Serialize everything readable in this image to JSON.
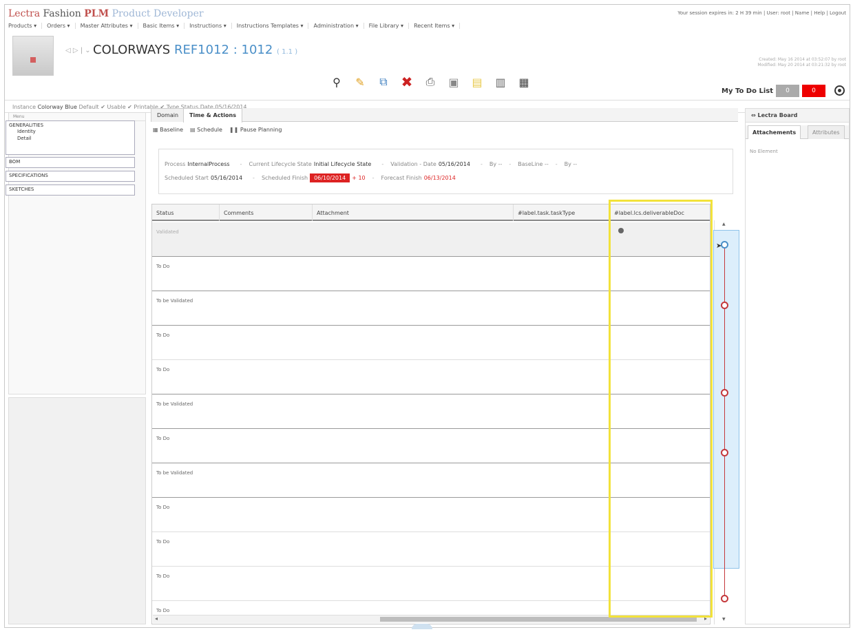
{
  "brand": {
    "part1": "Lectra",
    "part2": "Fashion",
    "part3": "PLM",
    "part4": "Product Developer"
  },
  "session": {
    "text": "Your session expires in: 2 H 39 min | User: root | Name | Help | Logout"
  },
  "menu": [
    "Products ▾",
    "Orders ▾",
    "Master Attributes ▾",
    "Basic Items ▾",
    "Instructions ▾",
    "Instructions Templates ▾",
    "Administration ▾",
    "File Library ▾",
    "Recent Items ▾"
  ],
  "title": {
    "prefix": "COLORWAYS",
    "ref": "REF1012 : 1012",
    "version": "( 1.1 )"
  },
  "created": {
    "line1": "Created: May 16 2014 at 03:52:07 by root",
    "line2": "Modified: May 20 2014 at 03:21:32 by root"
  },
  "todo": {
    "label": "My To Do List",
    "count_grey": "0",
    "count_red": "0"
  },
  "instance": {
    "label": "Instance",
    "value": "Colorway Blue",
    "default": "Default ✔",
    "usable": "Usable ✔",
    "printable": "Printable ✔",
    "type": "Type",
    "status": "Status",
    "date": "Date 05/16/2014"
  },
  "left_nav": {
    "header": "Menu",
    "groups": [
      {
        "label": "GENERALITIES",
        "items": [
          "Identity",
          "Detail"
        ]
      },
      {
        "label": "BOM"
      },
      {
        "label": "SPECIFICATIONS"
      },
      {
        "label": "SKETCHES"
      }
    ]
  },
  "tabs": {
    "domain": "Domain",
    "time_actions": "Time & Actions"
  },
  "subtool": {
    "baseline": "Baseline",
    "schedule": "Schedule",
    "pause": "Pause Planning"
  },
  "process": {
    "process_label": "Process",
    "process_value": "InternalProcess",
    "state_label": "Current Lifecycle State",
    "state_value": "Initial Lifecycle State",
    "validation_label": "Validation - Date",
    "validation_value": "05/16/2014",
    "by1": "By --",
    "baseline": "BaseLine --",
    "by2": "By --",
    "sched_start_label": "Scheduled Start",
    "sched_start_value": "05/16/2014",
    "sched_finish_label": "Scheduled Finish",
    "sched_finish_value": "06/10/2014",
    "delta": "+ 10",
    "forecast_label": "Forecast Finish",
    "forecast_value": "06/13/2014"
  },
  "grid": {
    "columns": [
      "Status",
      "Comments",
      "Attachment",
      "#label.task.taskType",
      "#label.lcs.deliverableDoc"
    ],
    "rows": [
      "Validated",
      "To Do",
      "To be Validated",
      "To Do",
      "To Do",
      "To be Validated",
      "To Do",
      "To be Validated",
      "To Do",
      "To Do",
      "To Do",
      "To Do"
    ]
  },
  "right": {
    "header": "Lectra Board",
    "tab1": "Attachements",
    "tab2": "Attributes",
    "empty": "No Element"
  }
}
